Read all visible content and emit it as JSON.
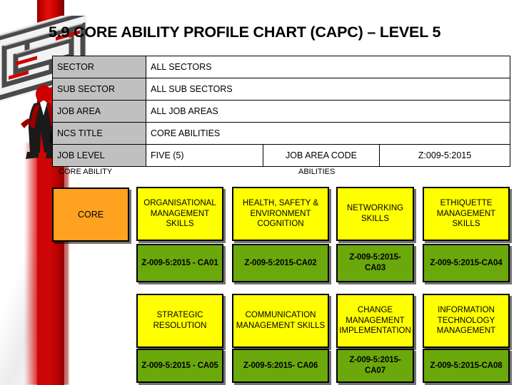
{
  "slide": {
    "title": "5.9  CORE ABILITY PROFILE CHART (CAPC)  – LEVEL 5"
  },
  "info_table": {
    "rows": [
      {
        "label": "SECTOR",
        "value": "ALL SECTORS"
      },
      {
        "label": "SUB SECTOR",
        "value": "ALL SUB SECTORS"
      },
      {
        "label": "JOB AREA",
        "value": "ALL JOB AREAS"
      },
      {
        "label": "NCS TITLE",
        "value": "CORE ABILITIES"
      }
    ],
    "job_level": {
      "label": "JOB LEVEL",
      "value": "FIVE (5)",
      "code_label": "JOB AREA CODE",
      "code_value": "Z:009-5:2015"
    }
  },
  "captions": {
    "core_ability": "CORE ABILITY",
    "abilities": "ABILITIES"
  },
  "core_box": {
    "label": "CORE"
  },
  "chart_data": {
    "type": "table",
    "title": "CORE ABILITY PROFILE CHART (CAPC) – LEVEL 5",
    "core_ability": "CORE",
    "columns": 4,
    "rows": 2,
    "abilities": [
      {
        "name": "ORGANISATIONAL MANAGEMENT SKILLS",
        "code": "Z-009-5:2015 - CA01",
        "row": 1,
        "col": 1
      },
      {
        "name": "HEALTH, SAFETY & ENVIRONMENT COGNITION",
        "code": "Z-009-5:2015-CA02",
        "row": 1,
        "col": 2
      },
      {
        "name": "NETWORKING SKILLS",
        "code": "Z-009-5:2015-CA03",
        "row": 1,
        "col": 3
      },
      {
        "name": "ETHIQUETTE MANAGEMENT SKILLS",
        "code": "Z-009-5:2015-CA04",
        "row": 1,
        "col": 4
      },
      {
        "name": "STRATEGIC RESOLUTION",
        "code": "Z-009-5:2015 - CA05",
        "row": 2,
        "col": 1
      },
      {
        "name": "COMMUNICATION MANAGEMENT SKILLS",
        "code": "Z-009-5:2015- CA06",
        "row": 2,
        "col": 2
      },
      {
        "name": "CHANGE MANAGEMENT IMPLEMENTATION",
        "code": "Z-009-5:2015-CA07",
        "row": 2,
        "col": 3
      },
      {
        "name": "INFORMATION TECHNOLOGY MANAGEMENT",
        "code": "Z-009-5:2015-CA08",
        "row": 2,
        "col": 4
      }
    ]
  },
  "colors": {
    "ability_fill": "#FFFF00",
    "code_fill": "#6AA80C",
    "core_fill": "#FFA220",
    "label_fill": "#C0C0C0",
    "accent_red": "#CC0000"
  }
}
